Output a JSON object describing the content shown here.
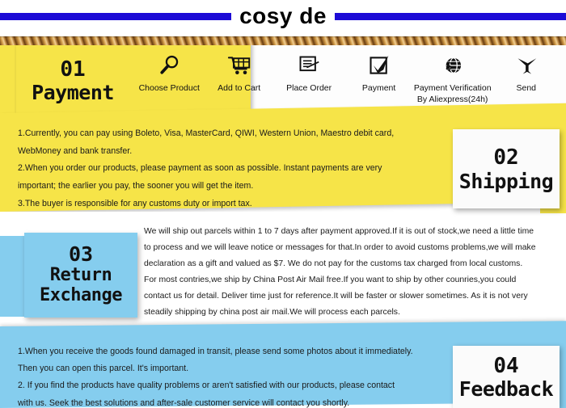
{
  "header": {
    "brand": "cosy de",
    "bar_color": "#1d0bd6"
  },
  "colors": {
    "yellow": "#f6e448",
    "blue": "#85cdee",
    "rope_brown": "#c08a3c",
    "text": "#1a1a1a"
  },
  "sections": {
    "payment": {
      "number": "01",
      "title": "Payment",
      "steps": [
        {
          "icon": "magnifier-icon",
          "label": "Choose Product",
          "label2": ""
        },
        {
          "icon": "shopping-cart-icon",
          "label": "Add to Cart",
          "label2": ""
        },
        {
          "icon": "document-order-icon",
          "label": "Place Order",
          "label2": ""
        },
        {
          "icon": "checkbox-checked-icon",
          "label": "Payment",
          "label2": ""
        },
        {
          "icon": "globe-dollar-icon",
          "label": "Payment Verification",
          "label2": "By Aliexpress(24h)"
        },
        {
          "icon": "airplane-icon",
          "label": "Send",
          "label2": ""
        }
      ],
      "lines": [
        "1.Currently, you can pay using Boleto, Visa, MasterCard, QIWI, Western Union, Maestro debit card,",
        "WebMoney and bank transfer.",
        "2.When you order our products, please payment as soon as possible. Instant payments are very",
        "important; the earlier you pay, the sooner you will get the item.",
        "3.The buyer is responsible for any customs duty or import tax."
      ]
    },
    "shipping": {
      "number": "02",
      "title": "Shipping"
    },
    "return_exchange": {
      "number": "03",
      "title_line1": "Return",
      "title_line2": "Exchange",
      "lines": [
        "We will ship out parcels within 1 to 7 days after payment approved.If it is out of stock,we need a little time",
        "to process and we will leave notice or messages for that.In order to avoid customs problems,we will make",
        " declaration as a gift and valued as $7. We do not pay for the customs tax charged from local customs.",
        "For most contries,we ship by China Post Air Mail free.If you want to ship by other counries,you could",
        "contact us for detail. Deliver time just for reference.It will be faster or slower sometimes. As it is not very",
        "steadily shipping by china post air mail.We will process each parcels."
      ]
    },
    "feedback": {
      "number": "04",
      "title": "Feedback",
      "lines": [
        "1.When you receive the goods found damaged in transit, please send some photos about it immediately.",
        "Then you can open this parcel. It's important.",
        "2. If you find the products have quality problems or aren't satisfied with our products,  please contact",
        "with us. Seek the best solutions and after-sale customer service will contact you shortly."
      ]
    }
  }
}
